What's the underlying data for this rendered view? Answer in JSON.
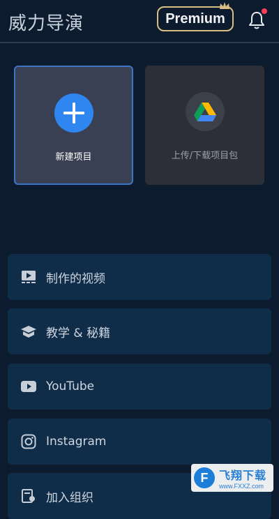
{
  "header": {
    "title": "威力导演",
    "premium_label": "Premium",
    "premium_color": "#d7bf86",
    "notification_badge_color": "#ff3d57"
  },
  "cards": {
    "new_project": {
      "label": "新建项目",
      "icon": "plus-icon",
      "accent": "#2f86f0"
    },
    "drive": {
      "label": "上传/下载项目包",
      "icon": "google-drive-icon"
    }
  },
  "menu": [
    {
      "label": "制作的视频",
      "icon": "video-library-icon"
    },
    {
      "label": "教学 & 秘籍",
      "icon": "graduation-cap-icon"
    },
    {
      "label": "YouTube",
      "icon": "youtube-icon"
    },
    {
      "label": "Instagram",
      "icon": "instagram-icon"
    },
    {
      "label": "加入组织",
      "icon": "group-icon"
    }
  ],
  "watermark": {
    "logo_letter": "F",
    "main": "飞翔下载",
    "sub": "www.FXXZ.com"
  }
}
